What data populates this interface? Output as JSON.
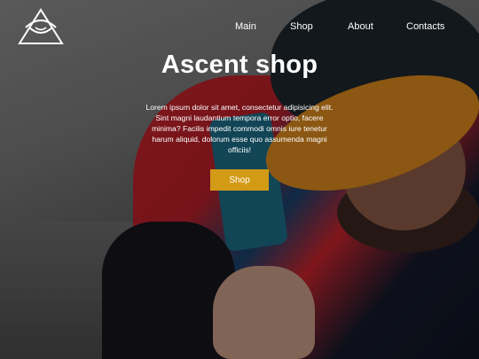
{
  "brand": {
    "logo_icon": "triangle-eye-icon"
  },
  "nav": {
    "items": [
      "Main",
      "Shop",
      "About",
      "Contacts"
    ]
  },
  "hero": {
    "title": "Ascent shop",
    "description": "Lorem ipsum dolor sit amet, consectetur adipisicing elit. Sint magni laudantium tempora error optio, facere minima? Facilis impedit commodi omnis iure tenetur harum aliquid, dolorum esse quo assumenda magni officiis!",
    "cta_label": "Shop"
  },
  "colors": {
    "accent": "#d39a16",
    "text": "#ffffff"
  }
}
